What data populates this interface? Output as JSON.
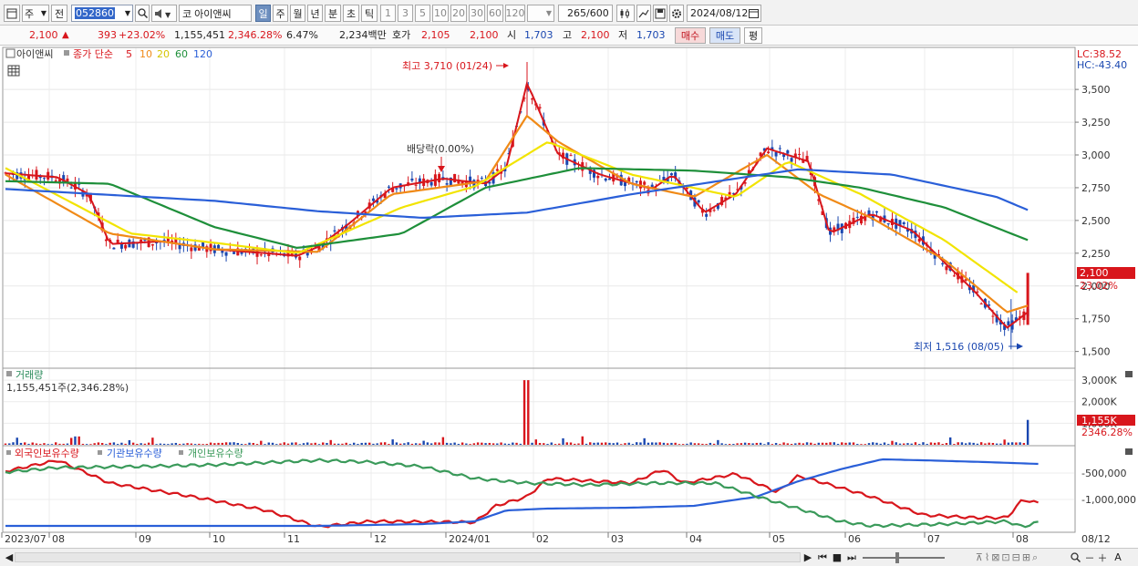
{
  "toolbar": {
    "period_main": "주",
    "prev_label": "전",
    "stock_code": "052860",
    "market_prefix": "코",
    "stock_name": "아이앤씨",
    "periods": [
      "일",
      "주",
      "월",
      "년",
      "분",
      "초",
      "틱"
    ],
    "active_period": "일",
    "intervals": [
      "1",
      "3",
      "5",
      "10",
      "20",
      "30",
      "60",
      "120"
    ],
    "count_display": "265",
    "count_total": "/600",
    "date": "2024/08/12"
  },
  "quote": {
    "price": "2,100",
    "up_mark": "▲",
    "change": "393",
    "change_pct": "+23.02%",
    "volume": "1,155,451",
    "volume_ratio": "2,346.28%",
    "turnover": "6.47%",
    "trade_value": "2,234백만",
    "ask_label": "호가",
    "ask1": "2,105",
    "ask2": "2,100",
    "open_label": "시",
    "open": "1,703",
    "high_label": "고",
    "high": "2,100",
    "low_label": "저",
    "low": "1,703",
    "buy_label": "매수",
    "sell_label": "매도",
    "avg_label": "평"
  },
  "price_panel": {
    "legend_name": "아이앤씨",
    "legend_indicator": "종가 단순",
    "ma_periods": [
      "5",
      "10",
      "20",
      "60",
      "120"
    ],
    "ma_colors": [
      "#d8161c",
      "#f08a17",
      "#f2e400",
      "#1e8f3a",
      "#2a5fd8"
    ],
    "lc": "LC:38.52",
    "hc": "HC:-43.40",
    "y_ticks": [
      "3,500",
      "3,250",
      "3,000",
      "2,750",
      "2,500",
      "2,250",
      "2,000",
      "1,750",
      "1,500"
    ],
    "last_price_tag": "2,100",
    "last_pct_tag": "23.02%",
    "high_note": "최고 3,710 (01/24)",
    "low_note": "최저 1,516 (08/05)",
    "dividend_note": "배당락(0.00%)"
  },
  "volume_panel": {
    "title": "거래량",
    "value_line": "1,155,451주(2,346.28%)",
    "y_ticks": [
      "3,000K",
      "2,000K",
      "1,000K"
    ],
    "last_tag": "1,155K",
    "last_pct": "2346.28%"
  },
  "holding_panel": {
    "series_names": [
      "외국인보유수량",
      "기관보유수량",
      "개인보유수량"
    ],
    "series_colors": [
      "#d8161c",
      "#2a5fd8",
      "#3a9a5a"
    ],
    "y_ticks": [
      "-500,000",
      "-1,000,000"
    ]
  },
  "x_axis": {
    "labels": [
      "2023/07",
      "08",
      "09",
      "10",
      "11",
      "12",
      "2024/01",
      "02",
      "03",
      "04",
      "05",
      "06",
      "07",
      "08"
    ],
    "right_label": "08/12"
  },
  "bottom": {
    "zoom_minus": "－",
    "zoom_plus": "＋",
    "a_label": "A"
  },
  "chart_data": {
    "type": "candlestick",
    "x_range": [
      "2023/07",
      "2024/08/12"
    ],
    "ylim": [
      1400,
      3800
    ],
    "series": [
      {
        "name": "5",
        "points": [
          [
            0,
            2860
          ],
          [
            0.05,
            2830
          ],
          [
            0.08,
            2700
          ],
          [
            0.1,
            2320
          ],
          [
            0.15,
            2340
          ],
          [
            0.2,
            2280
          ],
          [
            0.25,
            2250
          ],
          [
            0.28,
            2230
          ],
          [
            0.3,
            2300
          ],
          [
            0.33,
            2480
          ],
          [
            0.37,
            2750
          ],
          [
            0.42,
            2820
          ],
          [
            0.46,
            2780
          ],
          [
            0.48,
            2900
          ],
          [
            0.5,
            3550
          ],
          [
            0.53,
            3000
          ],
          [
            0.57,
            2850
          ],
          [
            0.62,
            2740
          ],
          [
            0.64,
            2850
          ],
          [
            0.67,
            2560
          ],
          [
            0.7,
            2700
          ],
          [
            0.73,
            3050
          ],
          [
            0.77,
            2950
          ],
          [
            0.79,
            2400
          ],
          [
            0.83,
            2550
          ],
          [
            0.87,
            2420
          ],
          [
            0.9,
            2180
          ],
          [
            0.93,
            1950
          ],
          [
            0.96,
            1680
          ],
          [
            0.98,
            1800
          ]
        ]
      },
      {
        "name": "10",
        "points": [
          [
            0,
            2850
          ],
          [
            0.1,
            2400
          ],
          [
            0.2,
            2280
          ],
          [
            0.3,
            2260
          ],
          [
            0.37,
            2700
          ],
          [
            0.46,
            2800
          ],
          [
            0.5,
            3300
          ],
          [
            0.53,
            3100
          ],
          [
            0.6,
            2780
          ],
          [
            0.66,
            2680
          ],
          [
            0.73,
            3000
          ],
          [
            0.78,
            2700
          ],
          [
            0.83,
            2520
          ],
          [
            0.9,
            2200
          ],
          [
            0.96,
            1800
          ],
          [
            0.98,
            1850
          ]
        ]
      },
      {
        "name": "20",
        "points": [
          [
            0,
            2900
          ],
          [
            0.12,
            2400
          ],
          [
            0.2,
            2330
          ],
          [
            0.28,
            2250
          ],
          [
            0.38,
            2600
          ],
          [
            0.45,
            2760
          ],
          [
            0.52,
            3100
          ],
          [
            0.6,
            2850
          ],
          [
            0.7,
            2680
          ],
          [
            0.75,
            2950
          ],
          [
            0.82,
            2700
          ],
          [
            0.9,
            2350
          ],
          [
            0.97,
            1950
          ]
        ]
      },
      {
        "name": "60",
        "points": [
          [
            0,
            2800
          ],
          [
            0.1,
            2780
          ],
          [
            0.2,
            2450
          ],
          [
            0.28,
            2290
          ],
          [
            0.38,
            2400
          ],
          [
            0.46,
            2750
          ],
          [
            0.55,
            2900
          ],
          [
            0.66,
            2880
          ],
          [
            0.75,
            2830
          ],
          [
            0.82,
            2750
          ],
          [
            0.9,
            2600
          ],
          [
            0.98,
            2350
          ]
        ]
      },
      {
        "name": "120",
        "points": [
          [
            0,
            2740
          ],
          [
            0.2,
            2650
          ],
          [
            0.3,
            2570
          ],
          [
            0.4,
            2520
          ],
          [
            0.5,
            2560
          ],
          [
            0.6,
            2700
          ],
          [
            0.7,
            2820
          ],
          [
            0.76,
            2890
          ],
          [
            0.85,
            2850
          ],
          [
            0.95,
            2680
          ],
          [
            0.98,
            2580
          ]
        ]
      }
    ],
    "high_point": {
      "value": 3710,
      "date": "01/24"
    },
    "low_point": {
      "value": 1516,
      "date": "08/05"
    },
    "last_close": 2100
  }
}
